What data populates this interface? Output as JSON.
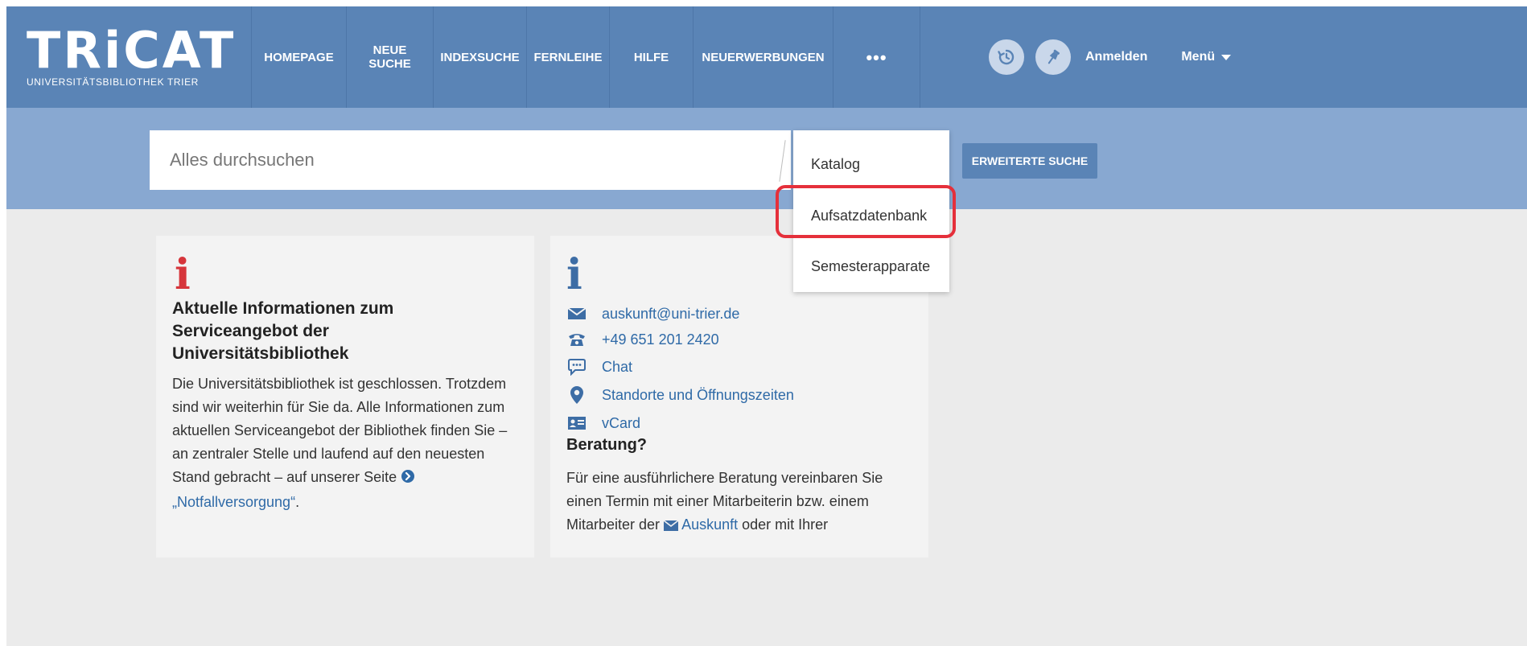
{
  "header": {
    "logo_text": "TRiCAT",
    "logo_sub": "UNIVERSITÄTSBIBLIOTHEK TRIER",
    "nav": [
      {
        "label": "HOMEPAGE"
      },
      {
        "label_line1": "NEUE",
        "label_line2": "SUCHE"
      },
      {
        "label": "INDEXSUCHE"
      },
      {
        "label": "FERNLEIHE"
      },
      {
        "label": "HILFE"
      },
      {
        "label": "NEUERWERBUNGEN"
      },
      {
        "label": "•••"
      }
    ],
    "history_icon": "history-icon",
    "pin_icon": "pin-icon",
    "login_label": "Anmelden",
    "menu_label": "Menü"
  },
  "search": {
    "placeholder": "Alles durchsuchen",
    "advanced_label": "ERWEITERTE SUCHE",
    "scope_options": [
      "Katalog",
      "Aufsatzdatenbank",
      "Semesterapparate"
    ],
    "highlighted_option": "Aufsatzdatenbank"
  },
  "left_card": {
    "icon": "info-icon",
    "title": "Aktuelle Informationen zum Serviceangebot der Universitätsbibliothek",
    "body_text": "Die Universitätsbibliothek ist geschlossen. Trotzdem sind wir weiterhin für Sie da. Alle Informationen zum aktuellen Serviceangebot der Bibliothek finden Sie – an zentraler Stelle und laufend auf den neuesten Stand gebracht – auf unserer Seite ",
    "link_text": "„Notfallversorgung“",
    "link_after": "."
  },
  "right_card": {
    "icon": "info-icon",
    "contacts": [
      {
        "icon": "envelope-icon",
        "label": "auskunft@uni-trier.de"
      },
      {
        "icon": "phone-icon",
        "label": "+49 651 201 2420"
      },
      {
        "icon": "chat-icon",
        "label": "Chat"
      },
      {
        "icon": "location-icon",
        "label": "Standorte und Öffnungszeiten"
      },
      {
        "icon": "vcard-icon",
        "label": "vCard"
      }
    ],
    "beratung_title": "Beratung?",
    "beratung_text_1": "Für eine ausführlichere Beratung vereinbaren Sie einen Termin mit einer Mitarbeiterin bzw. einem Mitarbeiter der ",
    "beratung_link": "Auskunft",
    "beratung_text_2": " oder mit Ihrer"
  },
  "colors": {
    "header_bg": "#5a84b6",
    "search_band_bg": "#88a8d1",
    "highlight_border": "#e5303b",
    "link": "#2f6aa7"
  }
}
